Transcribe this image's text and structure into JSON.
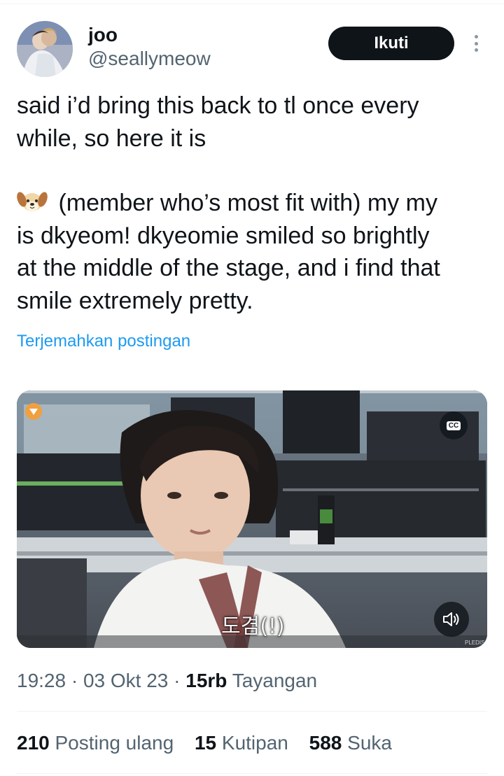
{
  "author": {
    "display_name": "joo",
    "handle": "@seallymeow"
  },
  "follow_label": "Ikuti",
  "tweet": {
    "line1": "said i’d bring this back to tl once every",
    "line2": "while, so here it is",
    "para2_line1": " (member who’s most fit with) my my",
    "para2_line2": "is dkyeom! dkyeomie smiled so brightly",
    "para2_line3": "at the middle of the stage, and i find that",
    "para2_line4": "smile extremely pretty."
  },
  "translate_label": "Terjemahkan postingan",
  "media": {
    "caption": "도겸(!)",
    "cc_label": "CC",
    "watermark": "PLEDIS"
  },
  "meta": {
    "time": "19:28",
    "sep1": " · ",
    "date": "03 Okt 23",
    "sep2": " · ",
    "views_count": "15rb",
    "views_label": " Tayangan"
  },
  "stats": {
    "reposts_count": "210",
    "reposts_label": " Posting ulang",
    "quotes_count": "15",
    "quotes_label": " Kutipan",
    "likes_count": "588",
    "likes_label": " Suka"
  },
  "colors": {
    "link": "#1d9bf0",
    "secondary_text": "#536471",
    "primary_text": "#0f1419",
    "follow_button_bg": "#0f1419"
  },
  "icons": [
    "dog-face-emoji",
    "more-options-icon",
    "closed-captions-icon",
    "volume-icon"
  ]
}
